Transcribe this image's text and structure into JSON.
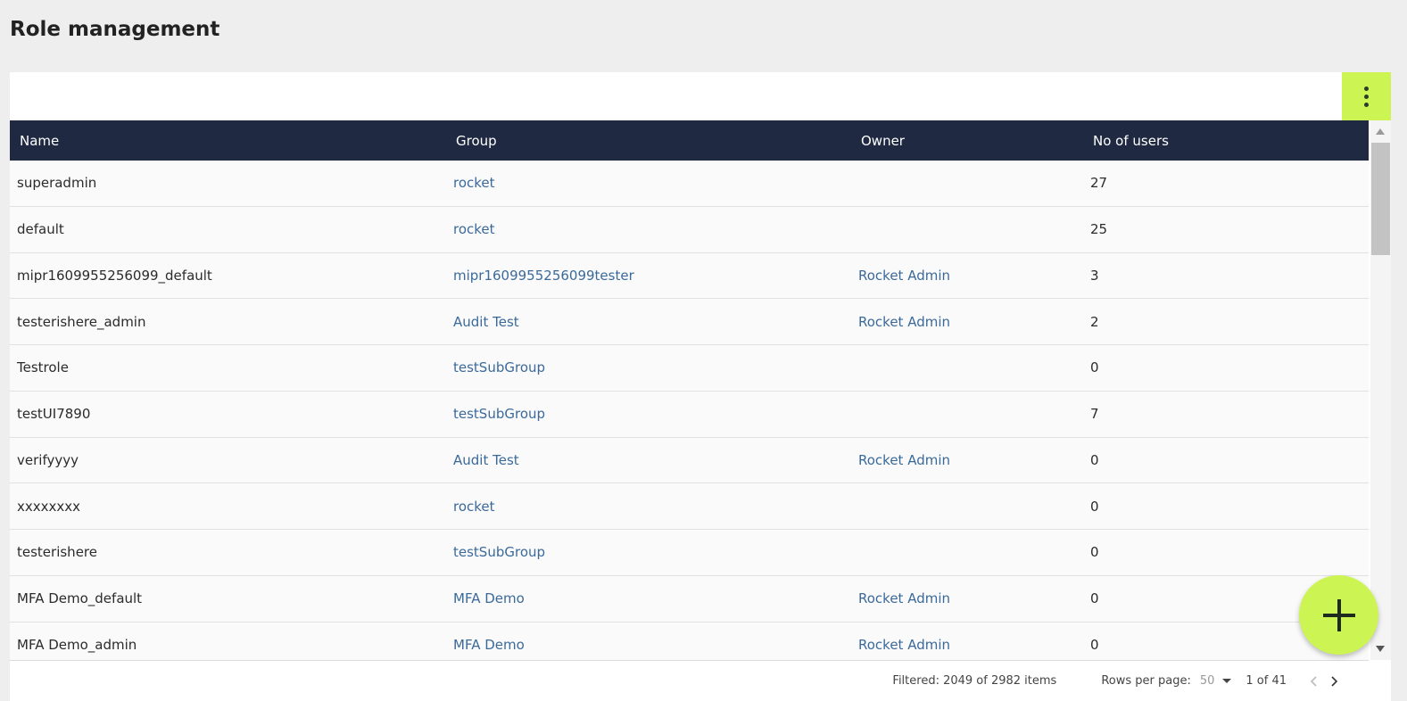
{
  "page": {
    "title": "Role management"
  },
  "table": {
    "columns": [
      "Name",
      "Group",
      "Owner",
      "No of users"
    ],
    "rows": [
      {
        "name": "superadmin",
        "group": "rocket",
        "owner": "",
        "users": "27"
      },
      {
        "name": "default",
        "group": "rocket",
        "owner": "",
        "users": "25"
      },
      {
        "name": "mipr1609955256099_default",
        "group": "mipr1609955256099tester",
        "owner": "Rocket Admin",
        "users": "3"
      },
      {
        "name": "testerishere_admin",
        "group": "Audit Test",
        "owner": "Rocket Admin",
        "users": "2"
      },
      {
        "name": "Testrole",
        "group": "testSubGroup",
        "owner": "",
        "users": "0"
      },
      {
        "name": "testUI7890",
        "group": "testSubGroup",
        "owner": "",
        "users": "7"
      },
      {
        "name": "verifyyyy",
        "group": "Audit Test",
        "owner": "Rocket Admin",
        "users": "0"
      },
      {
        "name": "xxxxxxxx",
        "group": "rocket",
        "owner": "",
        "users": "0"
      },
      {
        "name": "testerishere",
        "group": "testSubGroup",
        "owner": "",
        "users": "0"
      },
      {
        "name": "MFA Demo_default",
        "group": "MFA Demo",
        "owner": "Rocket Admin",
        "users": "0"
      },
      {
        "name": "MFA Demo_admin",
        "group": "MFA Demo",
        "owner": "Rocket Admin",
        "users": "0"
      }
    ]
  },
  "footer": {
    "filtered": "Filtered: 2049 of 2982 items",
    "rows_per_page_label": "Rows per page:",
    "rows_per_page_value": "50",
    "page_info": "1 of 41"
  },
  "icons": {
    "kebab": "more-vertical-icon",
    "add": "plus-icon",
    "prev": "chevron-left-icon",
    "next": "chevron-right-icon"
  },
  "colors": {
    "accent": "#ccf553",
    "header_bg": "#1f2942",
    "link": "#3b6a9a"
  }
}
